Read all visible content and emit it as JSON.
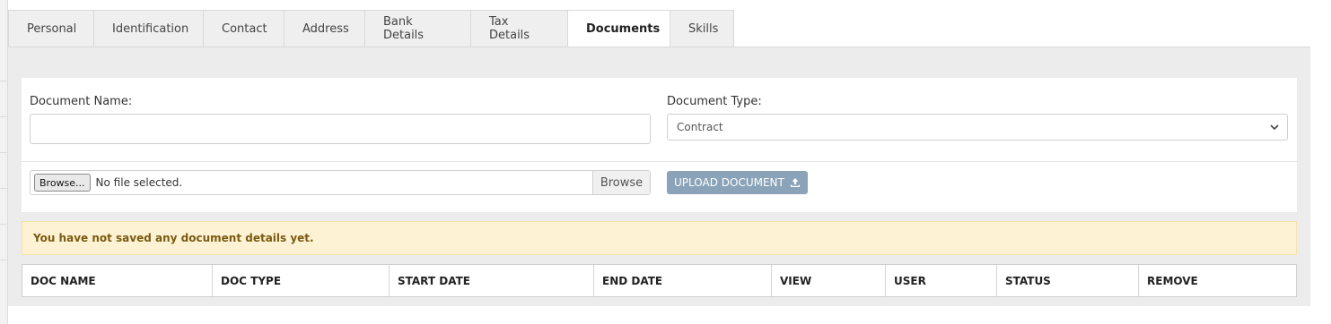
{
  "tabs": [
    {
      "label": "Personal"
    },
    {
      "label": "Identification"
    },
    {
      "label": "Contact"
    },
    {
      "label": "Address"
    },
    {
      "label": "Bank Details"
    },
    {
      "label": "Tax Details"
    },
    {
      "label": "Documents",
      "active": true
    },
    {
      "label": "Skills"
    }
  ],
  "form": {
    "document_name_label": "Document Name:",
    "document_name_value": "",
    "document_type_label": "Document Type:",
    "document_type_selected": "Contract",
    "file_button_label": "Browse...",
    "file_status": "No file selected.",
    "browse_label": "Browse",
    "upload_label": "UPLOAD DOCUMENT"
  },
  "alert": {
    "message": "You have not saved any document details yet."
  },
  "table": {
    "columns": [
      "DOC NAME",
      "DOC TYPE",
      "START DATE",
      "END DATE",
      "VIEW",
      "USER",
      "STATUS",
      "REMOVE"
    ]
  },
  "colors": {
    "upload_button": "#8aa3b8",
    "alert_background": "#fdf3d4",
    "alert_text": "#7a5a10"
  },
  "icons": {
    "upload": "upload-icon",
    "dropdown": "chevron-down-icon"
  }
}
